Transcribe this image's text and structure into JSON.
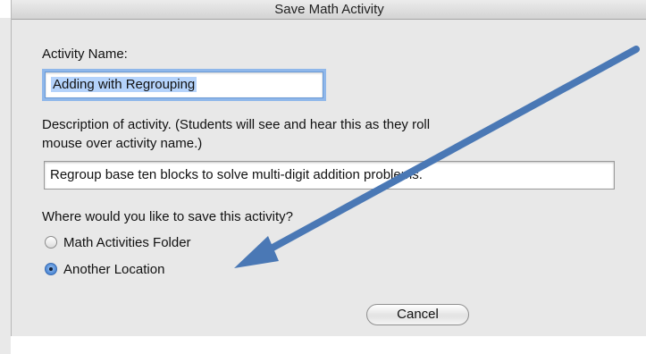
{
  "window": {
    "title": "Save Math Activity"
  },
  "form": {
    "name_label": "Activity Name:",
    "name_value": "Adding with Regrouping",
    "description_label": "Description of activity. (Students will see and hear this as they roll mouse over activity name.)",
    "description_label_line1": "Description of activity. (Students will see and hear this as they roll",
    "description_label_line2": "mouse over activity name.)",
    "description_value": "Regroup base ten blocks to solve multi-digit addition problems.",
    "location_question": "Where would you like to save this activity?",
    "options": [
      {
        "label": "Math Activities Folder",
        "selected": false
      },
      {
        "label": "Another Location",
        "selected": true
      }
    ],
    "cancel_label": "Cancel"
  },
  "annotation": {
    "arrow_color": "#4a78b5"
  }
}
